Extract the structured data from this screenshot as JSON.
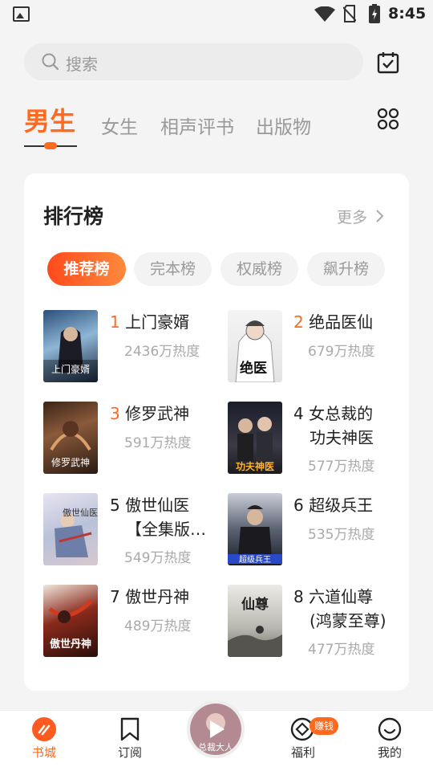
{
  "status_bar": {
    "time": "8:45"
  },
  "search": {
    "placeholder": "搜索"
  },
  "tabs": [
    {
      "label": "男生",
      "active": true
    },
    {
      "label": "女生"
    },
    {
      "label": "相声评书"
    },
    {
      "label": "出版物"
    }
  ],
  "ranking": {
    "title": "排行榜",
    "more": "更多",
    "chips": [
      {
        "label": "推荐榜",
        "active": true
      },
      {
        "label": "完本榜"
      },
      {
        "label": "权威榜"
      },
      {
        "label": "飙升榜"
      }
    ],
    "books": [
      {
        "rank": "1",
        "title": "上门豪婿",
        "heat": "2436万热度",
        "cover_text": "上门豪婿"
      },
      {
        "rank": "2",
        "title": "绝品医仙",
        "heat": "679万热度",
        "cover_text": "绝医"
      },
      {
        "rank": "3",
        "title": "修罗武神",
        "heat": "591万热度",
        "cover_text": "修罗武神"
      },
      {
        "rank": "4",
        "title": "女总裁的功夫神医",
        "title_line1": "女总裁的",
        "title_line2": "功夫神医",
        "heat": "577万热度",
        "cover_text": "功夫神医"
      },
      {
        "rank": "5",
        "title": "傲世仙医【全集版...",
        "title_line1": "傲世仙医",
        "title_line2": "【全集版…",
        "heat": "549万热度",
        "cover_text": "傲世仙医"
      },
      {
        "rank": "6",
        "title": "超级兵王",
        "heat": "535万热度",
        "cover_text": "超级兵王"
      },
      {
        "rank": "7",
        "title": "傲世丹神",
        "heat": "489万热度",
        "cover_text": "傲世丹神"
      },
      {
        "rank": "8",
        "title": "六道仙尊(鸿蒙至尊)",
        "title_line1": "六道仙尊",
        "title_line2": "(鸿蒙至尊)",
        "heat": "477万热度",
        "cover_text": "仙尊"
      }
    ]
  },
  "bottom_nav": [
    {
      "label": "书城",
      "icon": "bookstore-icon",
      "active": true
    },
    {
      "label": "订阅",
      "icon": "bookmark-icon"
    },
    {
      "label": "福利",
      "icon": "coin-icon",
      "badge": "赚钱"
    },
    {
      "label": "我的",
      "icon": "profile-icon"
    }
  ],
  "player": {
    "cover_text": "总裁大人"
  },
  "colors": {
    "accent": "#ff6a1f",
    "background": "#f4f4f4",
    "card": "#ffffff"
  }
}
